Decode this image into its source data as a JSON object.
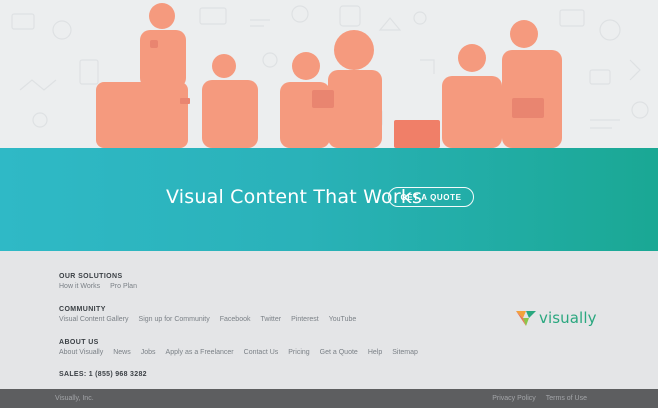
{
  "hero": {
    "overlay_color": "#f59a7e",
    "background_color": "#eceeef"
  },
  "cta": {
    "title": "Visual Content That Works",
    "button_label": "GET A QUOTE",
    "gradient_start": "#2fb9c6",
    "gradient_end": "#1aa894"
  },
  "footer": {
    "solutions": {
      "heading": "OUR SOLUTIONS",
      "links": [
        "How it Works",
        "Pro Plan"
      ]
    },
    "community": {
      "heading": "COMMUNITY",
      "links": [
        "Visual Content Gallery",
        "Sign up for Community",
        "Facebook",
        "Twitter",
        "Pinterest",
        "YouTube"
      ]
    },
    "about": {
      "heading": "ABOUT US",
      "links": [
        "About Visually",
        "News",
        "Jobs",
        "Apply as a Freelancer",
        "Contact Us",
        "Pricing",
        "Get a Quote",
        "Help",
        "Sitemap"
      ]
    },
    "sales": "SALES: 1 (855) 968 3282"
  },
  "logo": {
    "text": "visually",
    "color": "#2aa77f"
  },
  "bottom_bar": {
    "copyright": "Visually, Inc.",
    "links": [
      "Privacy Policy",
      "Terms of Use"
    ]
  }
}
